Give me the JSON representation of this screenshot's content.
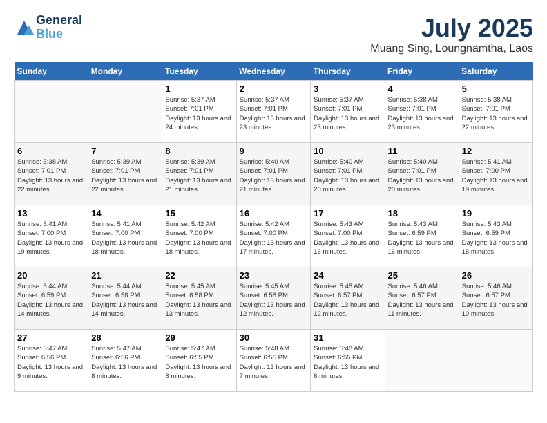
{
  "header": {
    "logo_line1": "General",
    "logo_line2": "Blue",
    "month": "July 2025",
    "location": "Muang Sing, Loungnamtha, Laos"
  },
  "weekdays": [
    "Sunday",
    "Monday",
    "Tuesday",
    "Wednesday",
    "Thursday",
    "Friday",
    "Saturday"
  ],
  "weeks": [
    [
      {
        "day": "",
        "info": ""
      },
      {
        "day": "",
        "info": ""
      },
      {
        "day": "1",
        "info": "Sunrise: 5:37 AM\nSunset: 7:01 PM\nDaylight: 13 hours\nand 24 minutes."
      },
      {
        "day": "2",
        "info": "Sunrise: 5:37 AM\nSunset: 7:01 PM\nDaylight: 13 hours\nand 23 minutes."
      },
      {
        "day": "3",
        "info": "Sunrise: 5:37 AM\nSunset: 7:01 PM\nDaylight: 13 hours\nand 23 minutes."
      },
      {
        "day": "4",
        "info": "Sunrise: 5:38 AM\nSunset: 7:01 PM\nDaylight: 13 hours\nand 23 minutes."
      },
      {
        "day": "5",
        "info": "Sunrise: 5:38 AM\nSunset: 7:01 PM\nDaylight: 13 hours\nand 22 minutes."
      }
    ],
    [
      {
        "day": "6",
        "info": "Sunrise: 5:38 AM\nSunset: 7:01 PM\nDaylight: 13 hours\nand 22 minutes."
      },
      {
        "day": "7",
        "info": "Sunrise: 5:39 AM\nSunset: 7:01 PM\nDaylight: 13 hours\nand 22 minutes."
      },
      {
        "day": "8",
        "info": "Sunrise: 5:39 AM\nSunset: 7:01 PM\nDaylight: 13 hours\nand 21 minutes."
      },
      {
        "day": "9",
        "info": "Sunrise: 5:40 AM\nSunset: 7:01 PM\nDaylight: 13 hours\nand 21 minutes."
      },
      {
        "day": "10",
        "info": "Sunrise: 5:40 AM\nSunset: 7:01 PM\nDaylight: 13 hours\nand 20 minutes."
      },
      {
        "day": "11",
        "info": "Sunrise: 5:40 AM\nSunset: 7:01 PM\nDaylight: 13 hours\nand 20 minutes."
      },
      {
        "day": "12",
        "info": "Sunrise: 5:41 AM\nSunset: 7:00 PM\nDaylight: 13 hours\nand 19 minutes."
      }
    ],
    [
      {
        "day": "13",
        "info": "Sunrise: 5:41 AM\nSunset: 7:00 PM\nDaylight: 13 hours\nand 19 minutes."
      },
      {
        "day": "14",
        "info": "Sunrise: 5:41 AM\nSunset: 7:00 PM\nDaylight: 13 hours\nand 18 minutes."
      },
      {
        "day": "15",
        "info": "Sunrise: 5:42 AM\nSunset: 7:00 PM\nDaylight: 13 hours\nand 18 minutes."
      },
      {
        "day": "16",
        "info": "Sunrise: 5:42 AM\nSunset: 7:00 PM\nDaylight: 13 hours\nand 17 minutes."
      },
      {
        "day": "17",
        "info": "Sunrise: 5:43 AM\nSunset: 7:00 PM\nDaylight: 13 hours\nand 16 minutes."
      },
      {
        "day": "18",
        "info": "Sunrise: 5:43 AM\nSunset: 6:59 PM\nDaylight: 13 hours\nand 16 minutes."
      },
      {
        "day": "19",
        "info": "Sunrise: 5:43 AM\nSunset: 6:59 PM\nDaylight: 13 hours\nand 15 minutes."
      }
    ],
    [
      {
        "day": "20",
        "info": "Sunrise: 5:44 AM\nSunset: 6:59 PM\nDaylight: 13 hours\nand 14 minutes."
      },
      {
        "day": "21",
        "info": "Sunrise: 5:44 AM\nSunset: 6:58 PM\nDaylight: 13 hours\nand 14 minutes."
      },
      {
        "day": "22",
        "info": "Sunrise: 5:45 AM\nSunset: 6:58 PM\nDaylight: 13 hours\nand 13 minutes."
      },
      {
        "day": "23",
        "info": "Sunrise: 5:45 AM\nSunset: 6:58 PM\nDaylight: 13 hours\nand 12 minutes."
      },
      {
        "day": "24",
        "info": "Sunrise: 5:45 AM\nSunset: 6:57 PM\nDaylight: 13 hours\nand 12 minutes."
      },
      {
        "day": "25",
        "info": "Sunrise: 5:46 AM\nSunset: 6:57 PM\nDaylight: 13 hours\nand 11 minutes."
      },
      {
        "day": "26",
        "info": "Sunrise: 5:46 AM\nSunset: 6:57 PM\nDaylight: 13 hours\nand 10 minutes."
      }
    ],
    [
      {
        "day": "27",
        "info": "Sunrise: 5:47 AM\nSunset: 6:56 PM\nDaylight: 13 hours\nand 9 minutes."
      },
      {
        "day": "28",
        "info": "Sunrise: 5:47 AM\nSunset: 6:56 PM\nDaylight: 13 hours\nand 8 minutes."
      },
      {
        "day": "29",
        "info": "Sunrise: 5:47 AM\nSunset: 6:55 PM\nDaylight: 13 hours\nand 8 minutes."
      },
      {
        "day": "30",
        "info": "Sunrise: 5:48 AM\nSunset: 6:55 PM\nDaylight: 13 hours\nand 7 minutes."
      },
      {
        "day": "31",
        "info": "Sunrise: 5:48 AM\nSunset: 6:55 PM\nDaylight: 13 hours\nand 6 minutes."
      },
      {
        "day": "",
        "info": ""
      },
      {
        "day": "",
        "info": ""
      }
    ]
  ]
}
